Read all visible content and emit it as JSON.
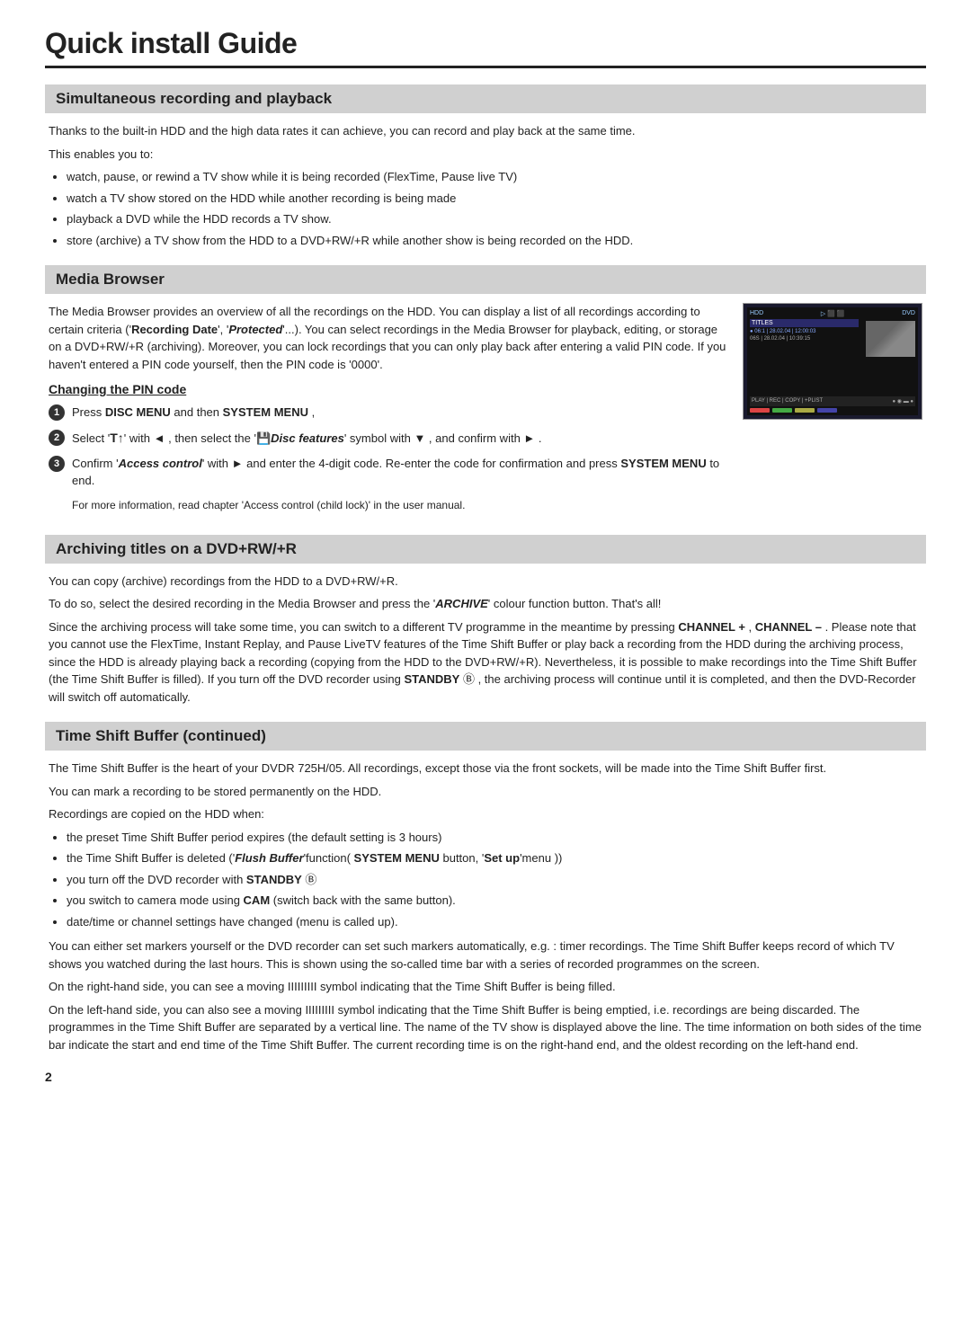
{
  "page": {
    "title": "Quick install Guide",
    "page_number": "2"
  },
  "sections": {
    "simultaneous": {
      "heading": "Simultaneous recording and playback",
      "intro": "Thanks to the built-in HDD and the high data rates it can achieve, you can record and play back at the same time.",
      "enables_label": "This enables you to:",
      "bullets": [
        "watch, pause, or rewind a TV show while it is being recorded (FlexTime, Pause live TV)",
        "watch a TV show stored on the HDD while another recording is being made",
        "playback a DVD while the HDD records a TV show.",
        "store (archive) a TV show from the HDD to a DVD+RW/+R while another show is being recorded on the HDD."
      ]
    },
    "media_browser": {
      "heading": "Media Browser",
      "body": "The Media Browser provides an overview of all the recordings on the HDD. You can display a list of all recordings according to certain criteria ('Recording Date', 'Protected'...). You can select recordings in the Media Browser for playback, editing, or storage on a DVD+RW/+R (archiving). Moreover, you can lock recordings that you can only play back after entering a valid PIN code. If you haven't entered a PIN code yourself, then the PIN code is '0000'.",
      "pin_section": {
        "heading": "Changing the PIN code",
        "step1": "Press DISC MENU and then SYSTEM MENU ,",
        "step2_pre": "Select '",
        "step2_symbol": "TA",
        "step2_mid": "' with ◄ , then select the '",
        "step2_disc": "Disc features",
        "step2_post": "' symbol with ▼ , and confirm with ► .",
        "step3_pre": "Confirm '",
        "step3_access": "Access control",
        "step3_post": "' with ► and enter the 4-digit code. Re-enter the code for confirmation and press SYSTEM MENU to end.",
        "step3_note": "For more information, read chapter 'Access control (child lock)' in the user manual."
      }
    },
    "archiving": {
      "heading": "Archiving titles on a DVD+RW/+R",
      "para1": "You can copy (archive) recordings from the HDD to a DVD+RW/+R.",
      "para2_pre": "To do so, select the desired recording in the Media Browser and press the '",
      "para2_archive": "ARCHIVE",
      "para2_post": "' colour function button. That's all!",
      "para3_pre": "Since the archiving process will take some time, you can switch to a different TV programme in the meantime by pressing ",
      "para3_ch_plus": "CHANNEL +",
      "para3_mid": " , ",
      "para3_ch_minus": "CHANNEL –",
      "para3_post": " . Please note that you cannot use the FlexTime, Instant Replay, and Pause LiveTV features of the Time Shift Buffer or play back a recording from the HDD during the archiving process, since the HDD is already playing back a recording (copying from the HDD to the DVD+RW/+R). Nevertheless, it is possible to make recordings into the Time Shift Buffer (the Time Shift Buffer is filled). If you turn off the DVD recorder using ",
      "para3_standby": "STANDBY",
      "para3_end": " , the archiving process will continue until it is completed, and then the DVD-Recorder will switch off automatically."
    },
    "time_shift": {
      "heading": "Time Shift Buffer (continued)",
      "para1": "The Time Shift Buffer is the heart of your DVDR 725H/05. All recordings, except those via the front sockets, will be made into the Time Shift Buffer first.",
      "para2": "You can mark a recording to be stored permanently on the HDD.",
      "para3": "Recordings are copied on the HDD when:",
      "bullets": [
        "the preset Time Shift Buffer period expires (the default setting is 3 hours)",
        "the Time Shift Buffer is deleted ('Flush Buffer' function( SYSTEM MENU button, 'Set up' menu ))",
        "you turn off the DVD recorder with STANDBY",
        "you switch to camera mode using  CAM (switch back with the same button).",
        "date/time or channel settings have changed (menu is called up)."
      ],
      "para4": "You can either set markers yourself or the DVD recorder can set such markers automatically, e.g. : timer recordings. The Time Shift Buffer keeps record of which TV shows you watched during the last hours. This is shown using the so-called time bar with a series of recorded programmes on the screen.",
      "para5": "On the right-hand side, you can see a moving IIIIIIIII symbol indicating that the Time Shift Buffer is being filled.",
      "para6": "On the left-hand side, you can also see a moving IIIIIIIII symbol indicating that the Time Shift Buffer is being emptied, i.e. recordings are being discarded. The programmes in the Time Shift Buffer are separated by a vertical line. The name of the TV show is displayed above the line. The time information on both sides of the time bar indicate the start and end time of the Time Shift Buffer. The current recording time is on the right-hand end, and the oldest recording on the left-hand end."
    }
  }
}
